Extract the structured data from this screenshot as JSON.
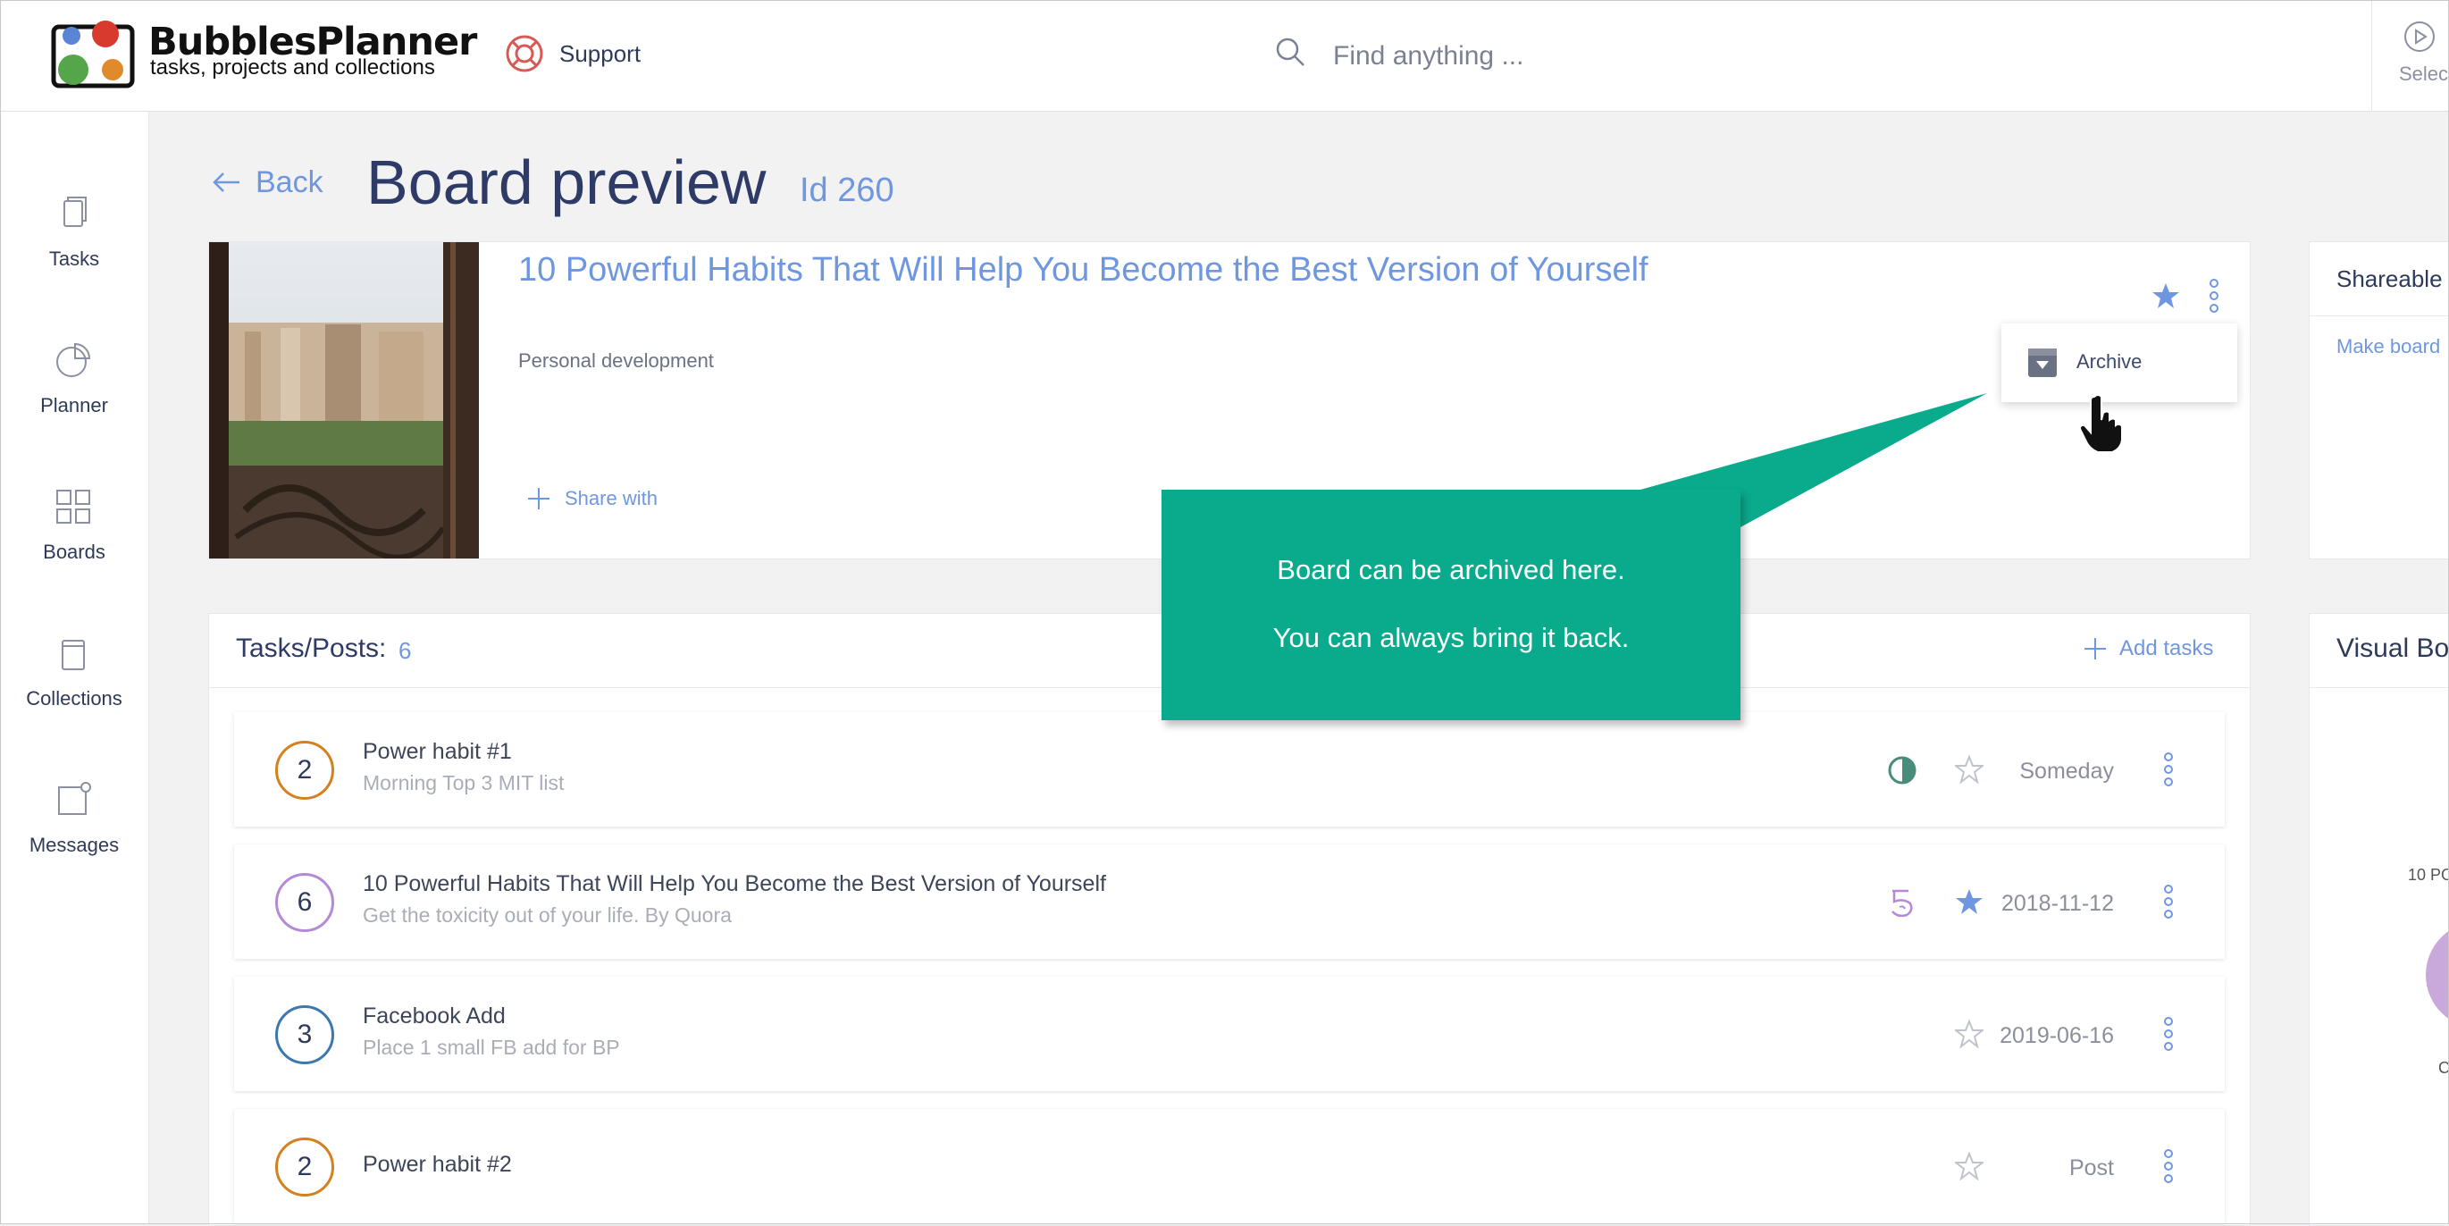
{
  "header": {
    "brand_title": "BubblesPlanner",
    "brand_subtitle": "tasks, projects and collections",
    "support_label": "Support",
    "search_placeholder": "Find anything ...",
    "select_label": "Select"
  },
  "sidebar": {
    "items": [
      {
        "label": "Tasks",
        "icon": "tasks-icon"
      },
      {
        "label": "Planner",
        "icon": "planner-icon"
      },
      {
        "label": "Boards",
        "icon": "boards-icon"
      },
      {
        "label": "Collections",
        "icon": "collections-icon"
      },
      {
        "label": "Messages",
        "icon": "messages-icon"
      }
    ]
  },
  "page": {
    "back_label": "Back",
    "title": "Board preview",
    "id_label": "Id 260"
  },
  "board": {
    "title": "10 Powerful Habits That Will Help You Become the Best Version of Yourself",
    "category": "Personal development",
    "share_label": "Share with",
    "starred": true,
    "menu": {
      "archive_label": "Archive"
    }
  },
  "callout": {
    "line1": "Board can be archived here.",
    "line2": "You can always bring it back.",
    "color": "#0aaa8d"
  },
  "shareable": {
    "title": "Shareable",
    "link_label": "Make board"
  },
  "visual": {
    "title": "Visual Bo",
    "label1": "10 PO",
    "label2": "C"
  },
  "tasks": {
    "label": "Tasks/Posts:",
    "count": "6",
    "add_label": "Add tasks",
    "rows": [
      {
        "number": "2",
        "ring_color": "#d4801f",
        "title": "Power habit #1",
        "subtitle": "Morning Top 3 MIT list",
        "status_icon": "half-circle-icon",
        "starred": false,
        "date": "Someday"
      },
      {
        "number": "6",
        "ring_color": "#b48ad6",
        "title": "10 Powerful Habits That Will Help You Become the Best Version of Yourself",
        "subtitle": "Get the toxicity out of your life. By Quora",
        "status_icon": "spiral-icon",
        "starred": true,
        "date": "2018-11-12"
      },
      {
        "number": "3",
        "ring_color": "#3c77ad",
        "title": "Facebook Add",
        "subtitle": "Place 1 small FB add for BP",
        "status_icon": "",
        "starred": false,
        "date": "2019-06-16"
      },
      {
        "number": "2",
        "ring_color": "#d4801f",
        "title": "Power habit #2",
        "subtitle": "",
        "status_icon": "",
        "starred": false,
        "date": "Post"
      }
    ]
  },
  "colors": {
    "accent": "#6f97e0",
    "title": "#2d3b66",
    "callout": "#0aaa8d"
  }
}
